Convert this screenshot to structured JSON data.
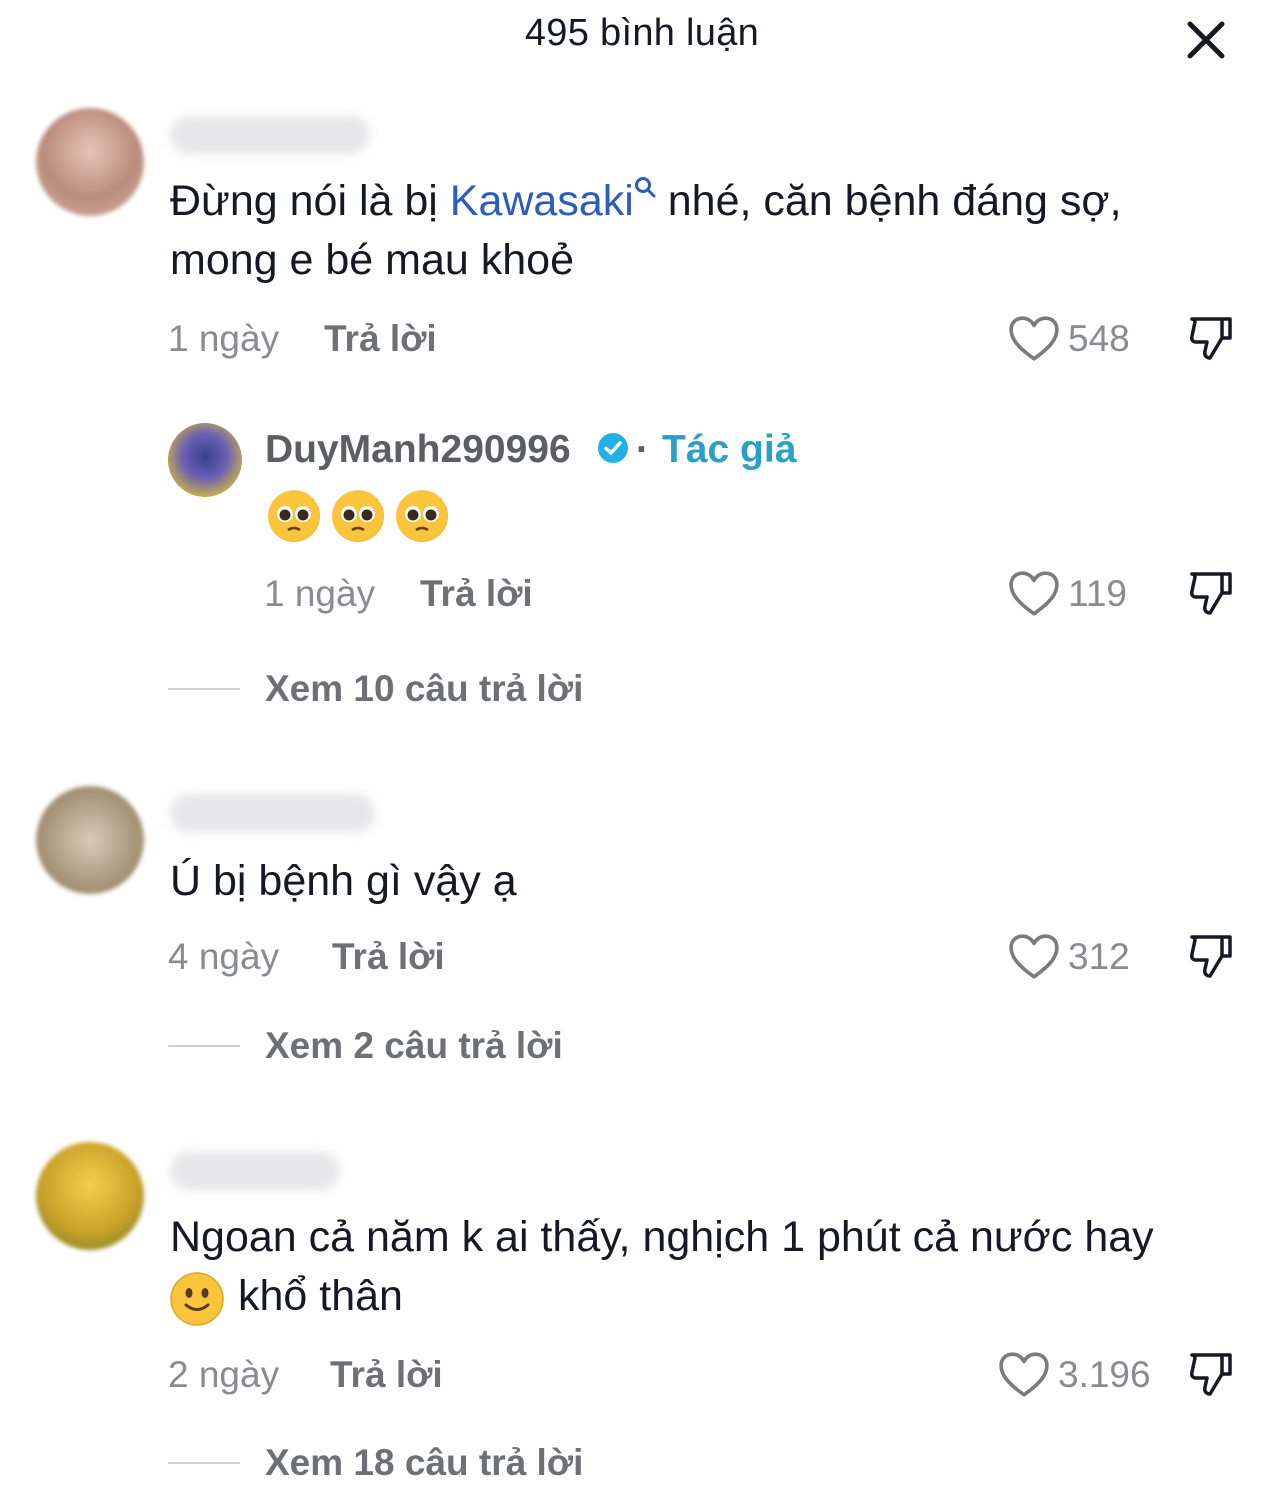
{
  "header": {
    "title": "495 bình luận",
    "close_icon": "close-icon"
  },
  "comments": [
    {
      "text_before": "Đừng nói là bị ",
      "keyword": "Kawasaki",
      "text_after": " nhé, căn bệnh đáng sợ,",
      "text_line2": "mong e bé mau khoẻ",
      "time": "1 ngày",
      "reply": "Trả lời",
      "likes": "548",
      "replies": [
        {
          "username": "DuyManh290996",
          "separator": "·",
          "author_badge": "Tác giả",
          "emojis": [
            "pleading-face",
            "pleading-face",
            "pleading-face"
          ],
          "time": "1 ngày",
          "reply": "Trả lời",
          "likes": "119"
        }
      ],
      "view_replies": "Xem 10 câu trả lời"
    },
    {
      "text": "Ú bị bệnh gì vậy ạ",
      "time": "4 ngày",
      "reply": "Trả lời",
      "likes": "312",
      "view_replies": "Xem 2 câu trả lời"
    },
    {
      "text_line1": "Ngoan cả năm k ai thấy, nghịch 1 phút cả nước hay",
      "emoji": "slightly-smiling-face",
      "text_line2": "khổ thân",
      "time": "2 ngày",
      "reply": "Trả lời",
      "likes": "3.196",
      "view_replies": "Xem 18 câu trả lời"
    }
  ],
  "colors": {
    "keyword": "#2b5db9",
    "author_badge": "#2aa0c8",
    "verified": "#20b2e6",
    "muted": "#8a8b91"
  }
}
